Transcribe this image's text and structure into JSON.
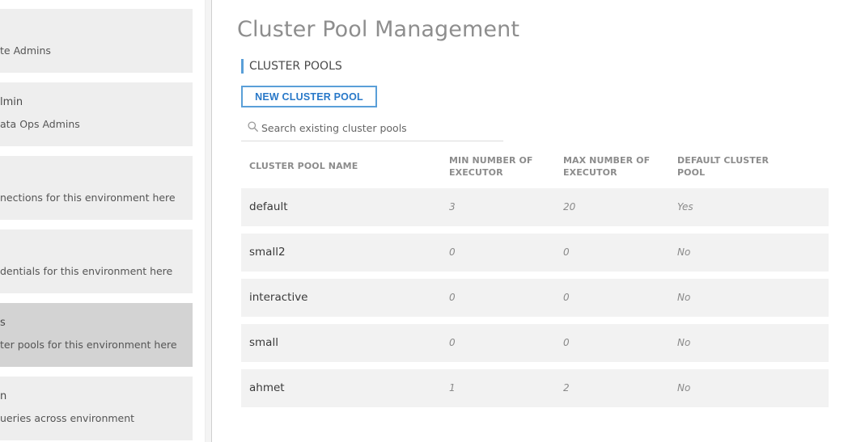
{
  "colors": {
    "accent": "#5a9fd8",
    "button_text": "#2878c8",
    "card_bg": "#eeeeee",
    "card_active_bg": "#d3d3d3",
    "row_bg": "#f2f2f2"
  },
  "sidebar": {
    "items": [
      {
        "title": "",
        "description": "te Admins",
        "active": false
      },
      {
        "title": "lmin",
        "description": "ata Ops Admins",
        "active": false
      },
      {
        "title": "",
        "description": "nections for this environment here",
        "active": false
      },
      {
        "title": "",
        "description": "dentials for this environment here",
        "active": false
      },
      {
        "title": "s",
        "description": "ter pools for this environment here",
        "active": true
      },
      {
        "title": "n",
        "description": "ueries across environment",
        "active": false
      }
    ]
  },
  "main": {
    "title": "Cluster Pool Management",
    "section_label": "CLUSTER POOLS",
    "new_button_label": "NEW CLUSTER POOL",
    "search": {
      "placeholder": "Search existing cluster pools",
      "value": "",
      "icon": "search-icon"
    },
    "table": {
      "columns": [
        "CLUSTER POOL NAME",
        "MIN NUMBER OF EXECUTOR",
        "MAX NUMBER OF EXECUTOR",
        "DEFAULT CLUSTER POOL"
      ],
      "rows": [
        {
          "name": "default",
          "min": "3",
          "max": "20",
          "default": "Yes"
        },
        {
          "name": "small2",
          "min": "0",
          "max": "0",
          "default": "No"
        },
        {
          "name": "interactive",
          "min": "0",
          "max": "0",
          "default": "No"
        },
        {
          "name": "small",
          "min": "0",
          "max": "0",
          "default": "No"
        },
        {
          "name": "ahmet",
          "min": "1",
          "max": "2",
          "default": "No"
        }
      ]
    }
  }
}
